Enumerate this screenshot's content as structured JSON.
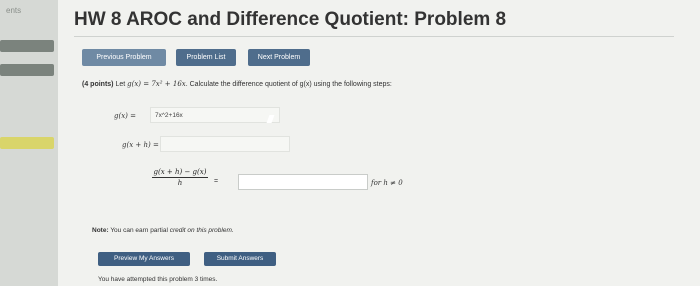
{
  "sidebar": {
    "top_text": "ents"
  },
  "header": {
    "title": "HW 8 AROC and Difference Quotient: Problem 8"
  },
  "nav": {
    "previous_label": "Previous Problem",
    "list_label": "Problem List",
    "next_label": "Next Problem"
  },
  "problem": {
    "points": "(4 points)",
    "statement_prefix": "Let",
    "function_def": "g(x) = 7x² + 16x",
    "statement_suffix": ". Calculate the difference quotient of g(x) using the following steps:"
  },
  "steps": {
    "gx_label": "g(x) =",
    "gx_value": "7x^2+16x",
    "gxh_label": "g(x + h) =",
    "dq_numerator": "g(x + h) − g(x)",
    "dq_denominator": "h",
    "equals": "=",
    "condition": "for h ≠ 0"
  },
  "note": {
    "label": "Note:",
    "text_normal": "You can earn partial",
    "text_italic": "credit on this problem."
  },
  "actions": {
    "preview_label": "Preview My Answers",
    "submit_label": "Submit Answers"
  },
  "footer": {
    "attempts": "You have attempted this problem 3 times."
  }
}
